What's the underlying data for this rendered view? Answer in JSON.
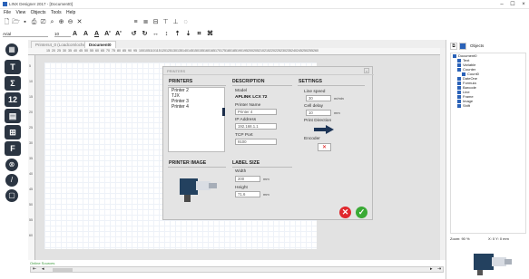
{
  "app": {
    "title": "LINX Designer 2017 - [Document0]",
    "window_buttons": [
      "–",
      "☐",
      "×"
    ]
  },
  "menu": [
    "File",
    "View",
    "Objects",
    "Tools",
    "Help"
  ],
  "font": {
    "name": "Arial",
    "size": "10"
  },
  "tabs": [
    "Printers4_0 (Loadcomlocher)",
    "Document0"
  ],
  "ruler_labels": [
    "15",
    "20",
    "25",
    "30",
    "35",
    "40",
    "45",
    "50",
    "55",
    "60",
    "65",
    "70",
    "75",
    "80",
    "85",
    "90",
    "95",
    "100",
    "105",
    "110",
    "115",
    "120",
    "125",
    "130",
    "135",
    "140",
    "145",
    "150",
    "155",
    "160",
    "165",
    "170",
    "175",
    "180",
    "185",
    "190",
    "195",
    "200",
    "205",
    "210",
    "215",
    "220",
    "225",
    "230",
    "235",
    "240",
    "245",
    "250",
    "255",
    "260"
  ],
  "vruler_labels": [
    "5",
    "10",
    "15",
    "20",
    "25",
    "30",
    "35",
    "40",
    "45",
    "50",
    "55",
    "60"
  ],
  "status": {
    "text": "Online Sources"
  },
  "right_panel": {
    "header": "Objects",
    "tree": [
      {
        "label": "Document0",
        "indent": 0
      },
      {
        "label": "Text",
        "indent": 1
      },
      {
        "label": "Variable",
        "indent": 1
      },
      {
        "label": "Counter",
        "indent": 1
      },
      {
        "label": "Count0",
        "indent": 2
      },
      {
        "label": "DateOne",
        "indent": 1
      },
      {
        "label": "Formula",
        "indent": 1
      },
      {
        "label": "Barcode",
        "indent": 1
      },
      {
        "label": "Line",
        "indent": 1
      },
      {
        "label": "Frame",
        "indent": 1
      },
      {
        "label": "Image",
        "indent": 1
      },
      {
        "label": "Shift",
        "indent": 1
      }
    ],
    "zoom_left": "Zoom: 90 %",
    "zoom_right": "X: 0 Y: 0 mm"
  },
  "dialog": {
    "title": "PRINTERS",
    "printers_header": "PRINTERS",
    "printers": [
      "Printer 2",
      "TJX",
      "Printer 3",
      "Printer 4"
    ],
    "description_header": "DESCRIPTION",
    "model_label": "Model",
    "model_value": "APLINK LCX 72",
    "printer_name_label": "Printer Name",
    "printer_name_value": "Printer 4",
    "ip_label": "IP Address",
    "ip_value": "192.168.1.1",
    "tcp_label": "TCP Port",
    "tcp_value": "9100",
    "settings_header": "SETTINGS",
    "line_speed_label": "Line speed",
    "line_speed_value": "30",
    "line_speed_unit": "m/min",
    "cell_delay_label": "Cell delay",
    "cell_delay_value": "10",
    "cell_delay_unit": "mm",
    "print_direction_label": "Print Direction",
    "encoder_label": "Encoder",
    "printer_image_header": "PRINTER IMAGE",
    "label_size_header": "LABEL SIZE",
    "width_label": "Width",
    "width_value": "200",
    "width_unit": "mm",
    "height_label": "Height",
    "height_value": "71.6",
    "height_unit": "mm"
  },
  "colors": {
    "accent": "#2a62b8",
    "dark_button": "#2b3542",
    "cancel": "#e0282e",
    "ok": "#3aaa35"
  }
}
